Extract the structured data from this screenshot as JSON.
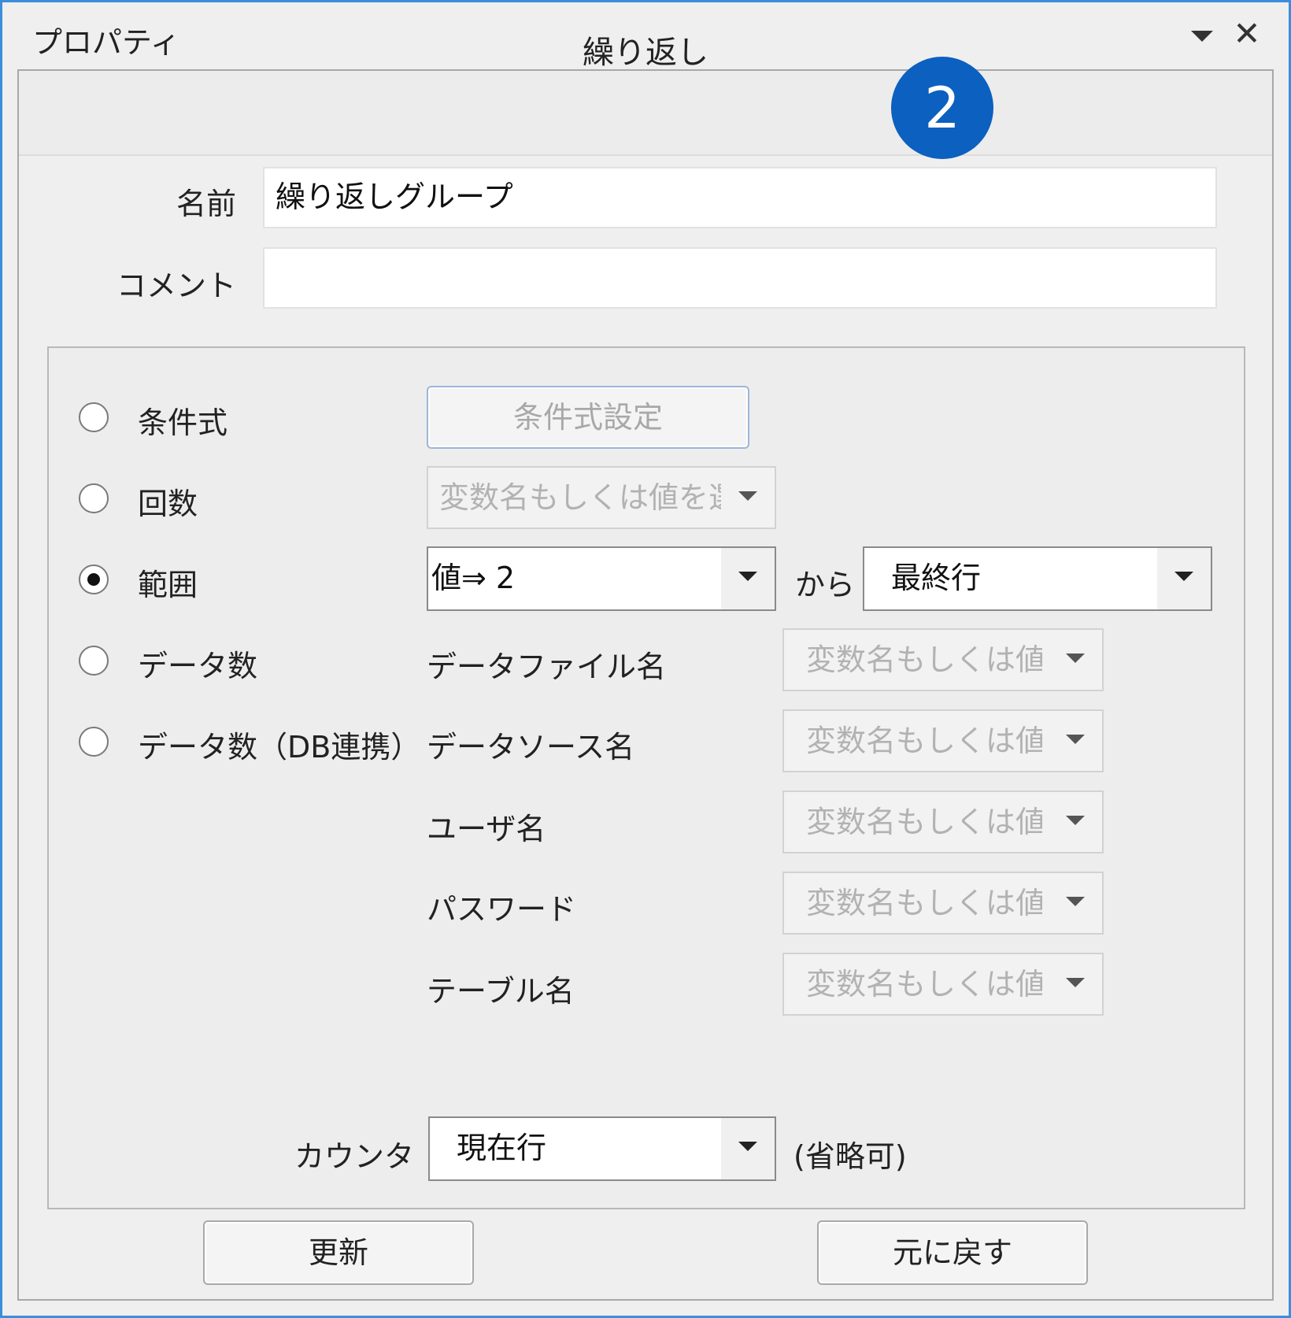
{
  "window": {
    "title": "プロパティ"
  },
  "header": {
    "title": "繰り返し"
  },
  "badge": {
    "number": "2",
    "color": "#0b60c0"
  },
  "fields": {
    "name": {
      "label": "名前",
      "value": "繰り返しグループ"
    },
    "comment": {
      "label": "コメント",
      "value": ""
    }
  },
  "loop": {
    "options": [
      {
        "label": "条件式",
        "checked": false
      },
      {
        "label": "回数",
        "checked": false
      },
      {
        "label": "範囲",
        "checked": true
      },
      {
        "label": "データ数",
        "checked": false
      },
      {
        "label": "データ数（DB連携）",
        "checked": false
      }
    ],
    "condition_button": "条件式設定",
    "count_combo": "変数名もしくは値を選",
    "range": {
      "from_value": "値⇒ 2",
      "connector": "から",
      "to_value": "最終行"
    },
    "data_file": {
      "label": "データファイル名",
      "placeholder": "変数名もしくは値を"
    },
    "data_source": {
      "label": "データソース名",
      "placeholder": "変数名もしくは値を"
    },
    "user": {
      "label": "ユーザ名",
      "placeholder": "変数名もしくは値を"
    },
    "password": {
      "label": "パスワード",
      "placeholder": "変数名もしくは値を"
    },
    "table": {
      "label": "テーブル名",
      "placeholder": "変数名もしくは値を"
    }
  },
  "counter": {
    "label": "カウンタ",
    "value": "現在行",
    "note": "(省略可)"
  },
  "buttons": {
    "update": "更新",
    "revert": "元に戻す"
  }
}
